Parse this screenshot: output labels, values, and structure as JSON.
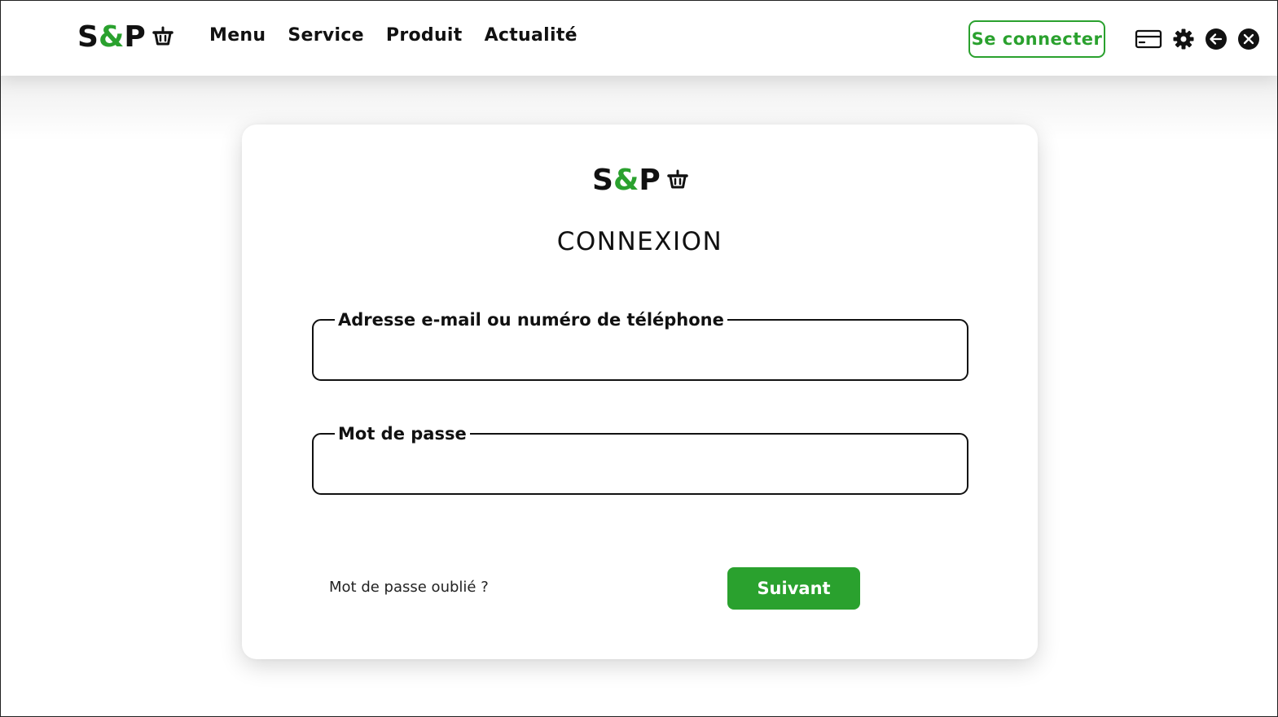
{
  "brand": {
    "s": "S",
    "amp": "&",
    "p": "P",
    "accent_color": "#2aa12e",
    "basket_icon": "basket-icon"
  },
  "nav": {
    "items": [
      {
        "label": "Menu"
      },
      {
        "label": "Service"
      },
      {
        "label": "Produit"
      },
      {
        "label": "Actualité"
      }
    ]
  },
  "header": {
    "login_label": "Se connecter",
    "icons": [
      "card-icon",
      "gear-icon",
      "back-arrow-icon",
      "close-icon"
    ]
  },
  "login": {
    "title": "CONNEXION",
    "email_label": "Adresse e-mail ou numéro de téléphone",
    "email_value": "",
    "password_label": "Mot de passe",
    "password_value": "",
    "forgot_label": "Mot de passe oublié ?",
    "next_label": "Suivant"
  }
}
